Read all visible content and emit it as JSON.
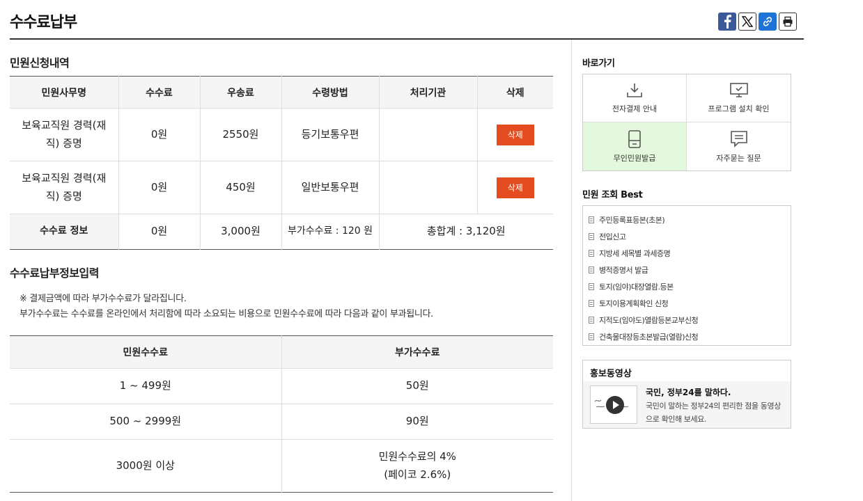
{
  "page": {
    "title": "수수료납부"
  },
  "share": {
    "facebook": "facebook-icon",
    "x": "x-icon",
    "link": "link-icon",
    "print": "print-icon"
  },
  "apply_section": {
    "title": "민원신청내역",
    "headers": [
      "민원사무명",
      "수수료",
      "우송료",
      "수령방법",
      "처리기관",
      "삭제"
    ],
    "rows": [
      {
        "name": "보육교직원 경력(재직) 증명",
        "fee": "0원",
        "postage": "2550원",
        "method": "등기보통우편",
        "agency": "",
        "delete_label": "삭제"
      },
      {
        "name": "보육교직원 경력(재직) 증명",
        "fee": "0원",
        "postage": "450원",
        "method": "일반보통우편",
        "agency": "",
        "delete_label": "삭제"
      }
    ],
    "summary": {
      "label": "수수료 정보",
      "fee": "0원",
      "postage": "3,000원",
      "extra": "부가수수료 : 120 원",
      "total": "총합계 : 3,120원"
    }
  },
  "payment_section": {
    "title": "수수료납부정보입력",
    "notice_1": "※ 결제금액에 따라 부가수수료가 달라집니다.",
    "notice_2": "부가수수료는 수수료를 온라인에서 처리함에 따라 소요되는 비용으로 민원수수료에 따라 다음과 같이 부과됩니다.",
    "headers": [
      "민원수수료",
      "부가수수료"
    ],
    "rows": [
      {
        "range": "1 ~ 499원",
        "extra": "50원"
      },
      {
        "range": "500 ~ 2999원",
        "extra": "90원"
      },
      {
        "range": "3000원 이상",
        "extra_line1": "민원수수료의 4%",
        "extra_line2": "(페이코 2.6%)"
      }
    ]
  },
  "sidebar": {
    "quick_title": "바로가기",
    "quick_links": [
      {
        "label": "전자결제 안내",
        "icon": "download-icon"
      },
      {
        "label": "프로그램 설치 확인",
        "icon": "monitor-icon"
      },
      {
        "label": "무인민원발급",
        "icon": "kiosk-icon"
      },
      {
        "label": "자주묻는 질문",
        "icon": "chat-icon"
      }
    ],
    "best_title": "민원 조회 Best",
    "best_items": [
      "주민등록표등본(초본)",
      "전입신고",
      "지방세 세목별 과세증명",
      "병적증명서 발급",
      "토지(임야)대장열람.등본",
      "토지이용계획확인 신청",
      "지적도(임야도)열람등본교부신청",
      "건축물대장등초본발급(열람)신청"
    ],
    "video": {
      "title": "홍보동영상",
      "headline": "국민, 정부24를 말하다.",
      "desc": "국민이 말하는 정부24의 편리한 점을 동영상으로 확인해 보세요."
    }
  },
  "colors": {
    "delete_button": "#e34c1e",
    "active_quick": "#e3f8dc",
    "facebook": "#3b5998",
    "link": "#1e73d6"
  }
}
